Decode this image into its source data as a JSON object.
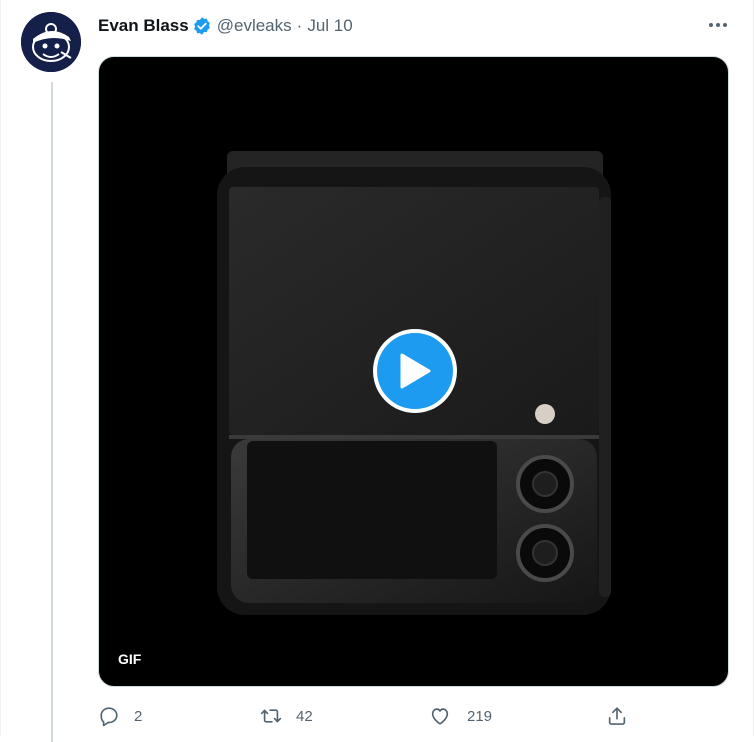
{
  "tweet": {
    "author_name": "Evan Blass",
    "handle": "@evleaks",
    "separator": "·",
    "date": "Jul 10",
    "verified": true,
    "avatar_icon": "cartoon-face-avatar",
    "more_icon": "more-horizontal-icon"
  },
  "media": {
    "badge": "GIF",
    "play_icon": "play-icon",
    "background_color": "#000000",
    "play_color": "#1d9bf0"
  },
  "actions": {
    "reply": {
      "icon": "reply-icon",
      "count": "2"
    },
    "retweet": {
      "icon": "retweet-icon",
      "count": "42"
    },
    "like": {
      "icon": "like-icon",
      "count": "219"
    },
    "share": {
      "icon": "share-icon"
    }
  },
  "colors": {
    "text_primary": "#0f1419",
    "text_secondary": "#536471",
    "accent": "#1d9bf0"
  }
}
